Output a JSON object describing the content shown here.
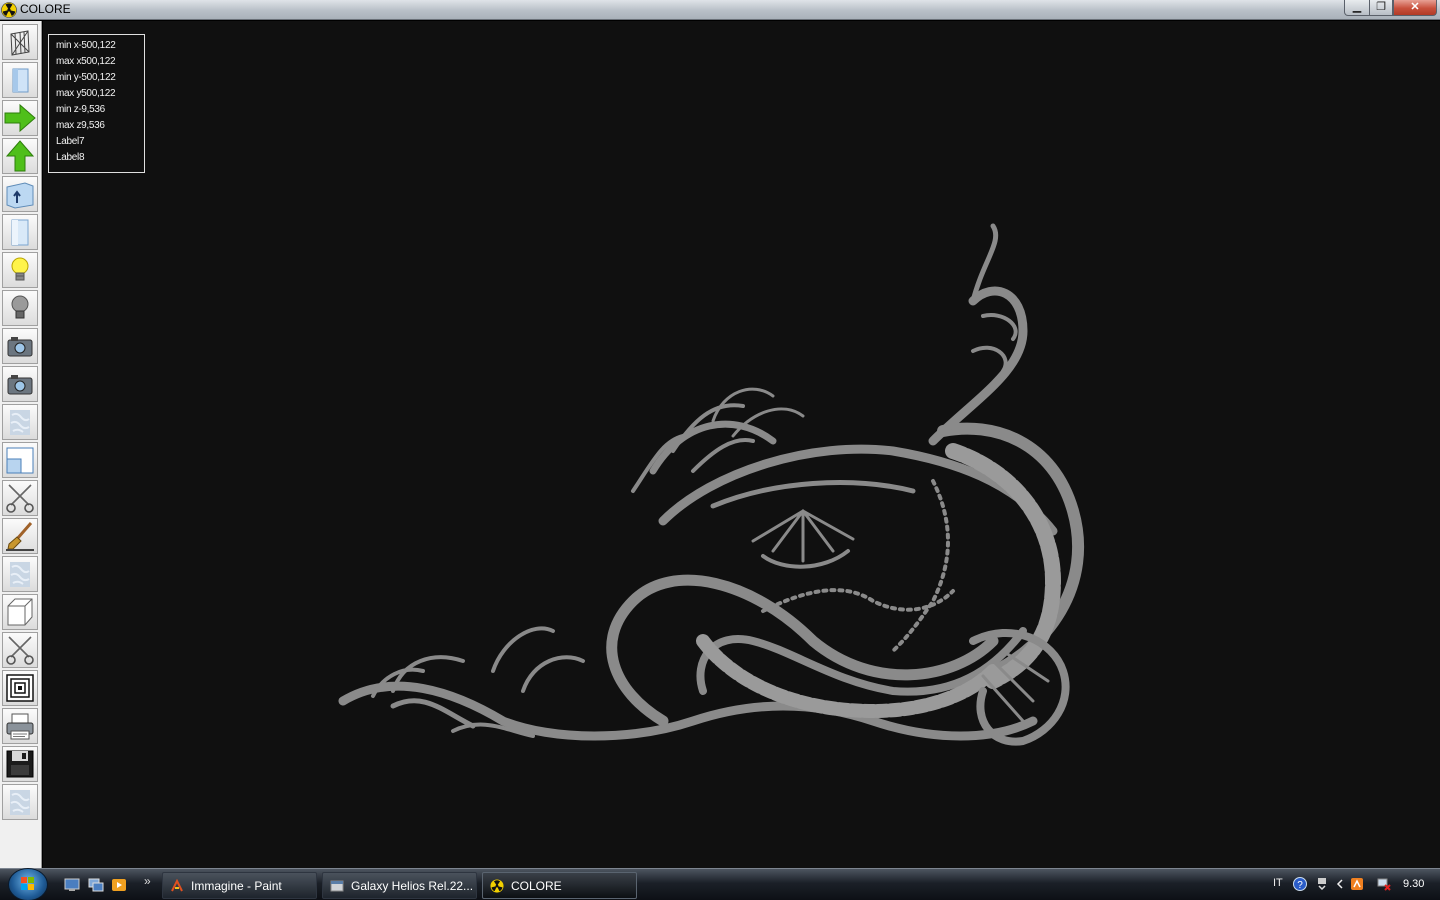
{
  "window": {
    "title": "COLORE",
    "minimize_label": "▁",
    "maximize_label": "❐",
    "close_label": "✕"
  },
  "toolbar": {
    "tools": [
      {
        "name": "wireframe-tool",
        "icon": "wireframe-icon"
      },
      {
        "name": "solid-view-tool",
        "icon": "solid-panel-icon"
      },
      {
        "name": "pan-right-tool",
        "icon": "arrow-right-icon"
      },
      {
        "name": "pan-up-tool",
        "icon": "arrow-up-icon"
      },
      {
        "name": "panel-tool",
        "icon": "panel-arrow-icon"
      },
      {
        "name": "panel-light-tool",
        "icon": "light-panel-icon"
      },
      {
        "name": "light-on-tool",
        "icon": "bulb-on-icon"
      },
      {
        "name": "light-off-tool",
        "icon": "bulb-off-icon"
      },
      {
        "name": "camera-tool",
        "icon": "camera-icon"
      },
      {
        "name": "camera-alt-tool",
        "icon": "camera-icon"
      },
      {
        "name": "texture-tool",
        "icon": "texture-icon"
      },
      {
        "name": "zoom-window-tool",
        "icon": "zoom-window-icon"
      },
      {
        "name": "cut-tool",
        "icon": "scissors-icon"
      },
      {
        "name": "paint-tool",
        "icon": "brush-icon"
      },
      {
        "name": "texture-alt-tool",
        "icon": "texture-icon"
      },
      {
        "name": "cube-tool",
        "icon": "cube-icon"
      },
      {
        "name": "cut-alt-tool",
        "icon": "scissors-icon"
      },
      {
        "name": "offset-tool",
        "icon": "concentric-squares-icon"
      },
      {
        "name": "print-tool",
        "icon": "printer-icon"
      },
      {
        "name": "save-tool",
        "icon": "floppy-disk-icon"
      },
      {
        "name": "texture-extra-tool",
        "icon": "texture-icon"
      }
    ]
  },
  "info": {
    "lines": [
      "min x-500,122",
      "max x500,122",
      "min y-500,122",
      "max y500,122",
      "min z-9,536",
      "max z9,536",
      "Label7",
      "Label8"
    ]
  },
  "taskbar": {
    "quick_launch_more": "»",
    "tasks": [
      {
        "label": "Immagine - Paint",
        "icon": "paint-icon",
        "active": false
      },
      {
        "label": "Galaxy Helios  Rel.22...",
        "icon": "app-window-icon",
        "active": false
      },
      {
        "label": "COLORE",
        "icon": "radiation-icon",
        "active": true
      }
    ],
    "tray": {
      "language": "IT",
      "clock": "9.30"
    }
  },
  "colors": {
    "viewport_bg": "#101010",
    "ornament": "#8a8a8a",
    "ornament_shadow": "#5a5a5a",
    "info_text": "#f2f2f2"
  }
}
